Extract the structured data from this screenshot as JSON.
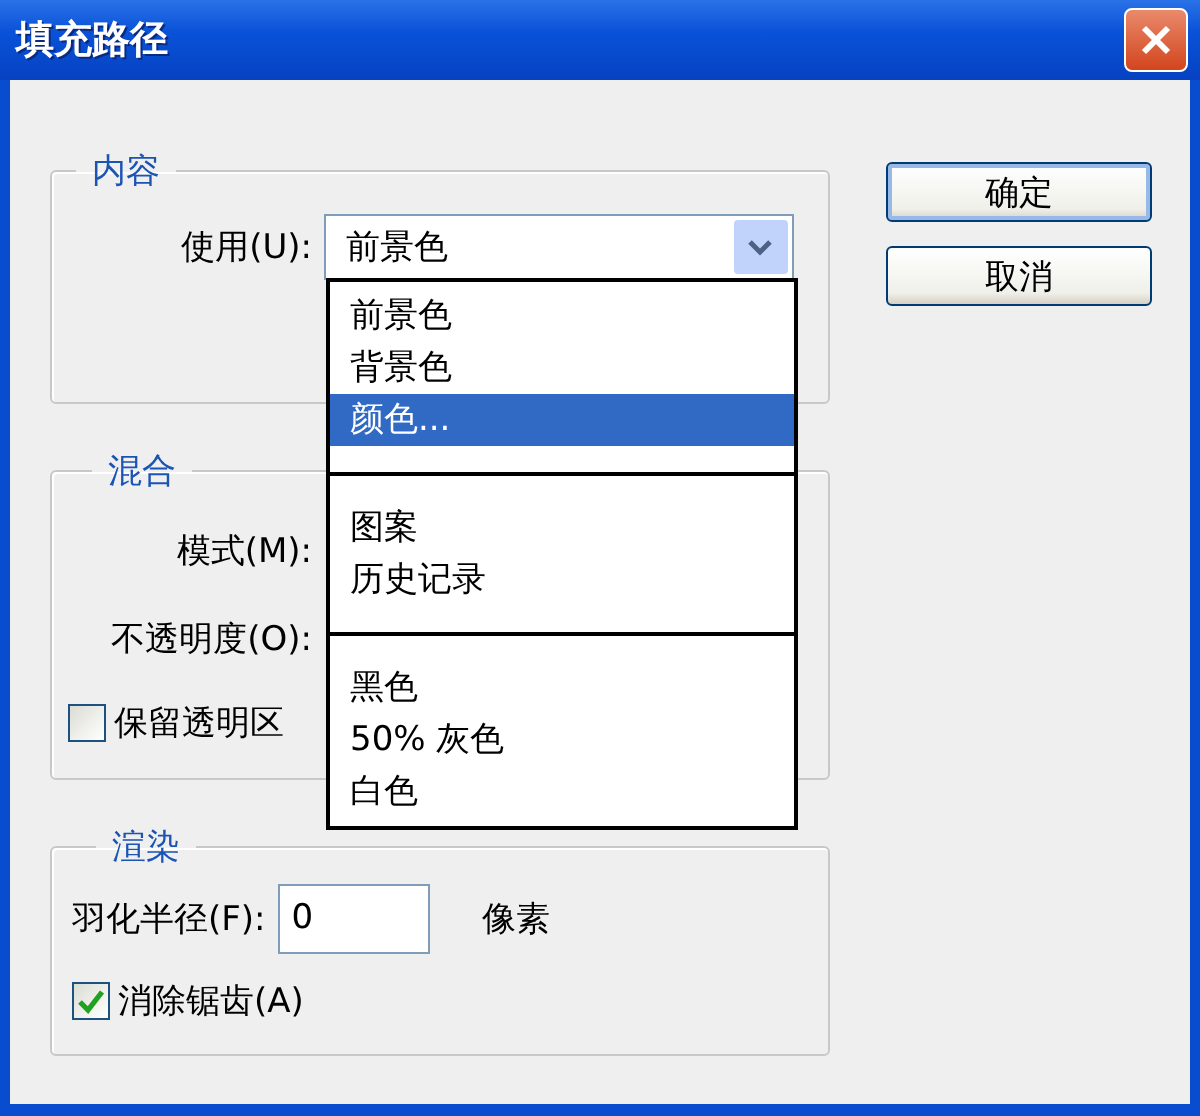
{
  "window": {
    "title": "填充路径"
  },
  "contents_group": {
    "title": "内容",
    "use_label": "使用(U):",
    "use_value": "前景色"
  },
  "blend_group": {
    "title": "混合",
    "mode_label": "模式(M):",
    "opacity_label": "不透明度(O):",
    "preserve_transparency": {
      "label": "保留透明区",
      "checked": false
    }
  },
  "render_group": {
    "title": "渲染",
    "feather_label": "羽化半径(F):",
    "feather_value": "0",
    "feather_unit": "像素",
    "anti_alias": {
      "label": "消除锯齿(A)",
      "checked": true
    }
  },
  "buttons": [
    "确定",
    "取消"
  ],
  "use_dropdown": [
    {
      "kind": "option",
      "label": "前景色",
      "selected": false
    },
    {
      "kind": "option",
      "label": "背景色",
      "selected": false
    },
    {
      "kind": "option",
      "label": "颜色...",
      "selected": true
    },
    {
      "kind": "separator"
    },
    {
      "kind": "option",
      "label": "图案",
      "selected": false
    },
    {
      "kind": "option",
      "label": "历史记录",
      "selected": false
    },
    {
      "kind": "separator"
    },
    {
      "kind": "option",
      "label": "黑色",
      "selected": false
    },
    {
      "kind": "option",
      "label": "50% 灰色",
      "selected": false
    },
    {
      "kind": "option",
      "label": "白色",
      "selected": false
    }
  ]
}
